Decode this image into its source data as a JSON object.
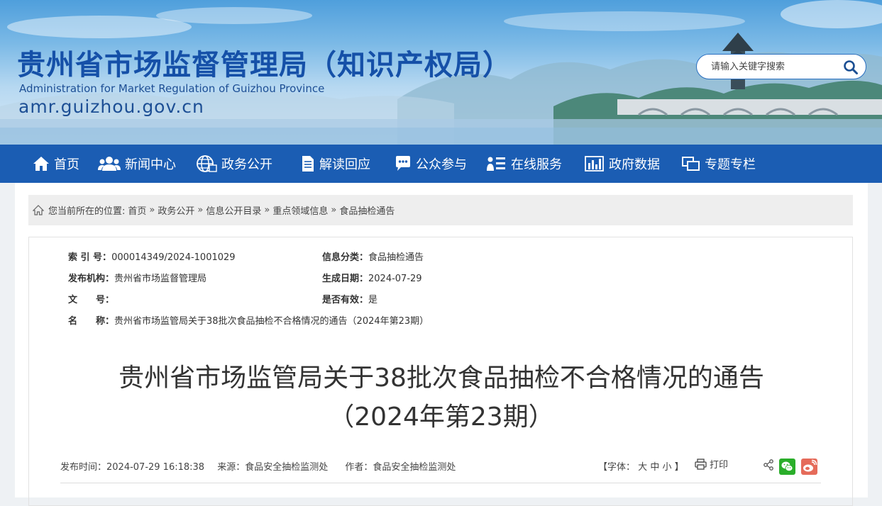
{
  "header": {
    "title": "贵州省市场监督管理局（知识产权局）",
    "title_en": "Administration for Market Regulation of Guizhou Province",
    "domain": "amr.guizhou.gov.cn",
    "search_placeholder": "请输入关键字搜索",
    "search_icon": "search-icon"
  },
  "nav": [
    {
      "label": "首页",
      "icon": "home-icon"
    },
    {
      "label": "新闻中心",
      "icon": "people-icon"
    },
    {
      "label": "政务公开",
      "icon": "globe-icon"
    },
    {
      "label": "解读回应",
      "icon": "document-icon"
    },
    {
      "label": "公众参与",
      "icon": "chat-icon"
    },
    {
      "label": "在线服务",
      "icon": "user-list-icon"
    },
    {
      "label": "政府数据",
      "icon": "bar-chart-icon"
    },
    {
      "label": "专题专栏",
      "icon": "windows-icon"
    }
  ],
  "breadcrumb": {
    "prefix": "您当前所在的位置:",
    "items": [
      "首页",
      "政务公开",
      "信息公开目录",
      "重点领域信息",
      "食品抽检通告"
    ],
    "separator": "»"
  },
  "meta": {
    "index_label": "索 引 号：",
    "index_value": "000014349/2024-1001029",
    "category_label": "信息分类：",
    "category_value": "食品抽检通告",
    "publisher_label": "发布机构：",
    "publisher_value": "贵州省市场监督管理局",
    "date_label": "生成日期：",
    "date_value": "2024-07-29",
    "doc_label": "文　　号：",
    "doc_value": "",
    "valid_label": "是否有效：",
    "valid_value": "是",
    "name_label": "名　　称：",
    "name_value": "贵州省市场监管局关于38批次食品抽检不合格情况的通告（2024年第23期）"
  },
  "article": {
    "title_line1": "贵州省市场监管局关于38批次食品抽检不合格情况的通告",
    "title_line2": "（2024年第23期）",
    "publish_time": "发布时间：2024-07-29 16:18:38",
    "source": "来源：食品安全抽检监测处",
    "author": "作者：食品安全抽检监测处",
    "font_prefix": "【字体：",
    "font_large": "大",
    "font_medium": "中",
    "font_small": "小",
    "font_suffix": "】",
    "print": "打印"
  },
  "colors": {
    "nav_bg": "#1b5db3",
    "title_blue": "#1550a8",
    "wechat": "#2aae2a",
    "weibo": "#e56b5a"
  }
}
